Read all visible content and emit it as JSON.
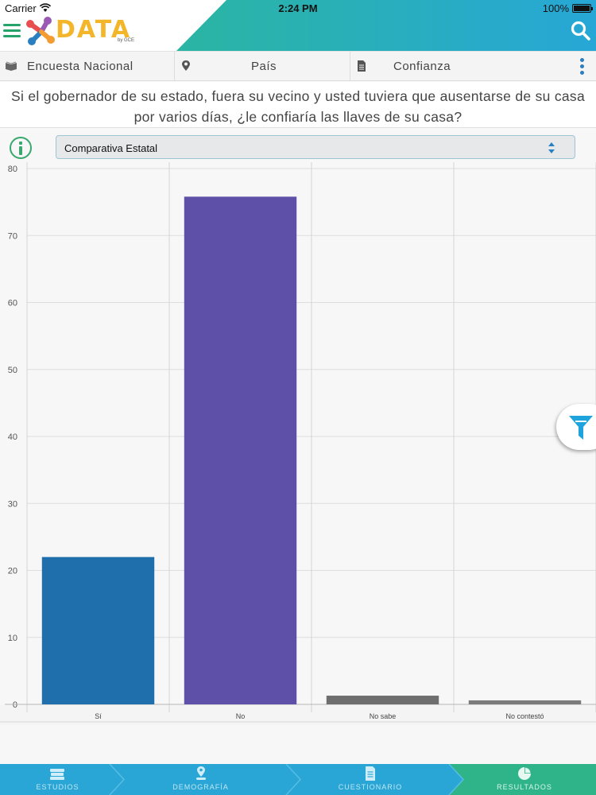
{
  "status_bar": {
    "carrier": "Carrier",
    "time": "2:24 PM",
    "battery": "100%"
  },
  "header": {
    "logo_text": "DATA",
    "logo_subtext": "by GCE",
    "icons": [
      "menu-icon",
      "search-icon"
    ],
    "colors": {
      "teal_start": "#2ab5a3",
      "teal_end": "#27a7d6",
      "accent_green": "#25a36a"
    }
  },
  "tabs": [
    {
      "label": "Encuesta Nacional",
      "icon": "book-icon"
    },
    {
      "label": "País",
      "icon": "location-pin-icon"
    },
    {
      "label": "Confianza",
      "icon": "document-icon"
    }
  ],
  "question": {
    "line1": "Si el gobernador de su estado, fuera su vecino y usted tuviera que ausentarse de su casa",
    "line2": "por varios días, ¿le confiaría las llaves de su casa?"
  },
  "selector": {
    "value": "Comparativa Estatal"
  },
  "chart_data": {
    "type": "bar",
    "categories": [
      "Sí",
      "No",
      "No sabe",
      "No contestó"
    ],
    "values": [
      22,
      75.8,
      1.3,
      0.6
    ],
    "colors": [
      "#1f6fad",
      "#5e4fa8",
      "#6e6e6e",
      "#7a7a7a"
    ],
    "title": "",
    "xlabel": "",
    "ylabel": "",
    "ylim": [
      0,
      80
    ],
    "yticks": [
      0,
      10,
      20,
      30,
      40,
      50,
      60,
      70,
      80
    ],
    "grid": true
  },
  "bottom_nav": [
    {
      "label": "ESTUDIOS",
      "icon": "books-icon",
      "active": false
    },
    {
      "label": "DEMOGRAFÍA",
      "icon": "location-pin-icon",
      "active": false
    },
    {
      "label": "CUESTIONARIO",
      "icon": "document-icon",
      "active": false
    },
    {
      "label": "RESULTADOS",
      "icon": "pie-chart-icon",
      "active": true
    }
  ]
}
